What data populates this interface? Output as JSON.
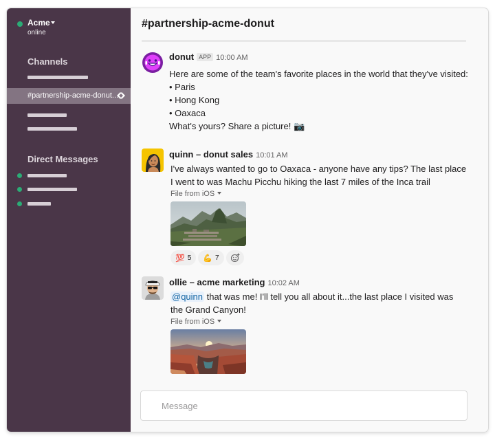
{
  "workspace": {
    "name": "Acme",
    "status": "online"
  },
  "sidebar": {
    "channels_title": "Channels",
    "active_channel": "#partnership-acme-donut...",
    "dm_title": "Direct Messages"
  },
  "channel": {
    "title": "#partnership-acme-donut"
  },
  "messages": [
    {
      "author": "donut",
      "badge": "APP",
      "time": "10:00 AM",
      "lines": [
        "Here are some of the team's favorite places in the world that they've visited:",
        "• Paris",
        "• Hong Kong",
        "• Oaxaca",
        "What's yours? Share a picture! 📷"
      ],
      "avatar_icon": "donut-bot-icon"
    },
    {
      "author": "quinn – donut sales",
      "time": "10:01 AM",
      "lines": [
        "I've always wanted to go to Oaxaca - anyone have any tips? The last place",
        "I went to was Machu Picchu hiking the last 7 miles of the Inca trail"
      ],
      "file_label": "File from iOS",
      "image": "machu-picchu-photo",
      "reactions": [
        {
          "emoji": "💯",
          "count": "5"
        },
        {
          "emoji": "💪",
          "count": "7"
        }
      ],
      "avatar_icon": "quinn-avatar"
    },
    {
      "author": "ollie – acme marketing",
      "time": "10:02 AM",
      "mention": "@quinn",
      "line1_rest": " that was me! I'll tell you all about it...the last place I visited was",
      "line2": "the Grand Canyon!",
      "file_label": "File from iOS",
      "image": "grand-canyon-photo",
      "avatar_icon": "ollie-avatar"
    }
  ],
  "composer": {
    "placeholder": "Message"
  },
  "colors": {
    "sidebar_bg": "#4a3648",
    "sidebar_active": "#837482",
    "presence": "#2bac76",
    "mention_bg": "#e8f1fb",
    "mention_text": "#1264a3"
  }
}
